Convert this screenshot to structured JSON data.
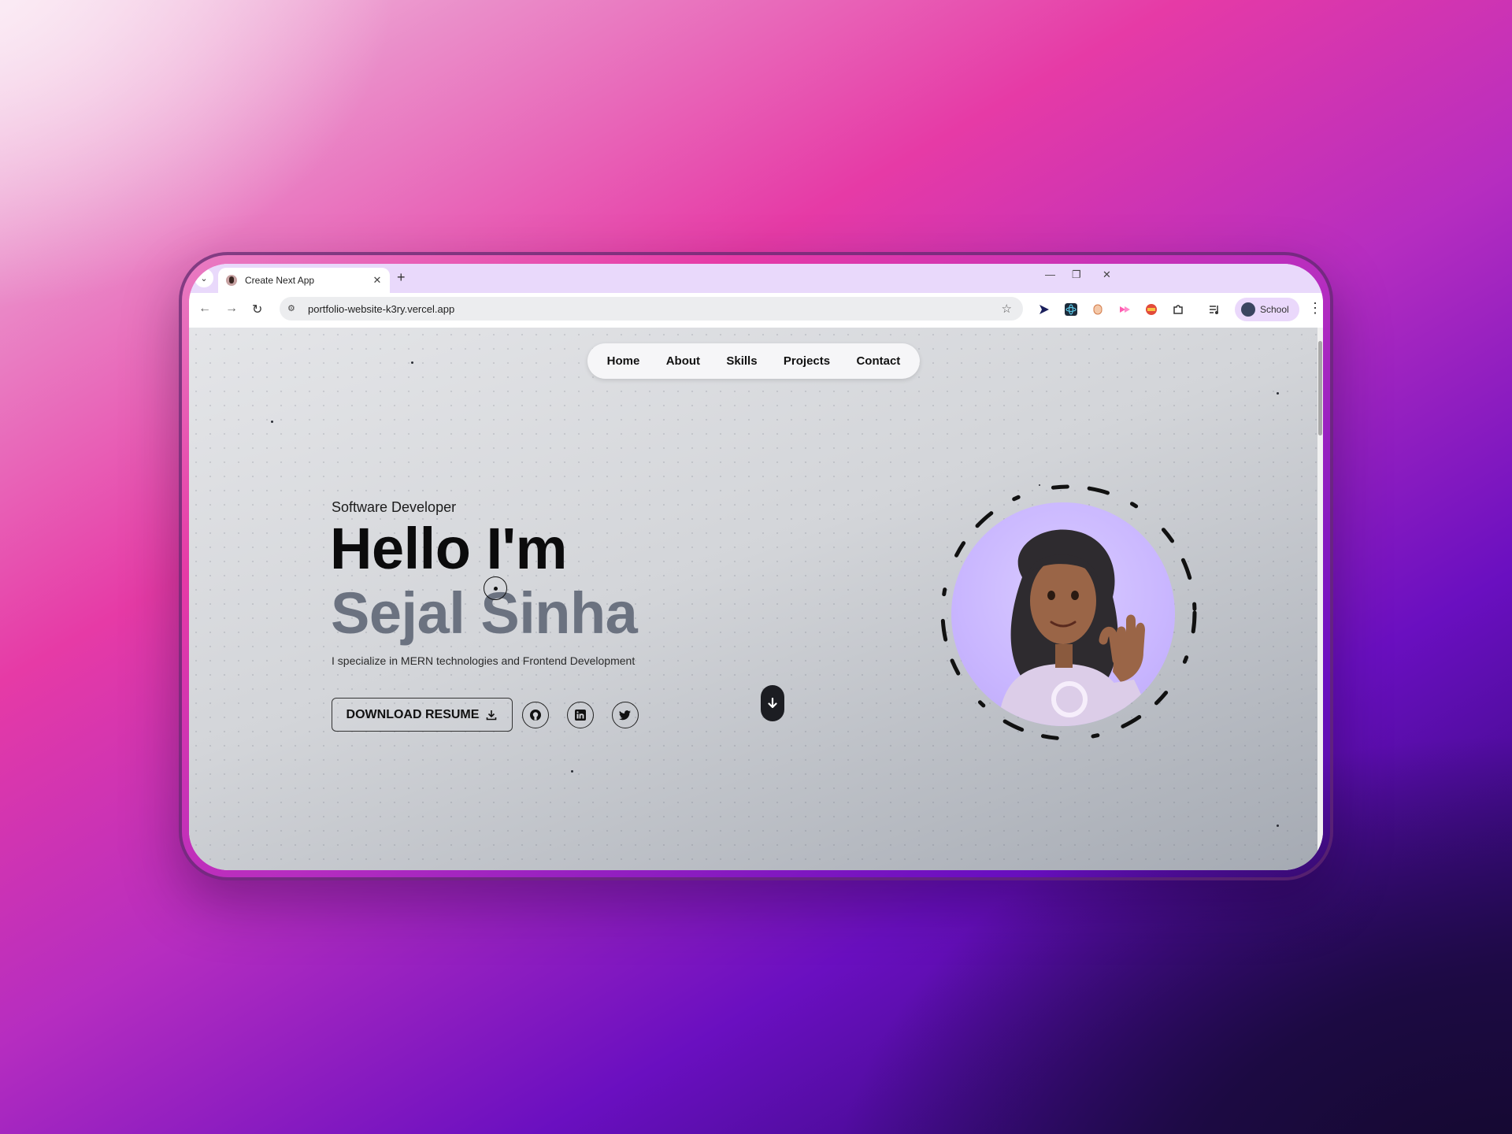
{
  "browser": {
    "tab_title": "Create Next App",
    "tab_close": "✕",
    "new_tab": "+",
    "url": "portfolio-website-k3ry.vercel.app",
    "profile_label": "School",
    "back": "←",
    "forward": "→",
    "reload": "↻",
    "minimize": "—",
    "restore": "❐",
    "close": "✕",
    "menu": "⋮",
    "star": "☆",
    "extensions": [
      "send-icon",
      "react-icon",
      "lock-extension-icon",
      "video-extension-icon",
      "shield-extension-icon",
      "puzzle-icon",
      "media-controls-icon"
    ]
  },
  "nav": {
    "items": [
      "Home",
      "About",
      "Skills",
      "Projects",
      "Contact"
    ]
  },
  "hero": {
    "subtitle": "Software Developer",
    "greeting": "Hello I'm",
    "name": "Sejal Sinha",
    "tagline": "I specialize in MERN technologies and Frontend Development",
    "resume_button": "DOWNLOAD RESUME",
    "social": [
      "github-icon",
      "linkedin-icon",
      "twitter-icon"
    ]
  },
  "colors": {
    "name_gray": "#6b7280",
    "avatar_bg": "#c9b6ff",
    "tabstrip": "#e9d9fb"
  }
}
